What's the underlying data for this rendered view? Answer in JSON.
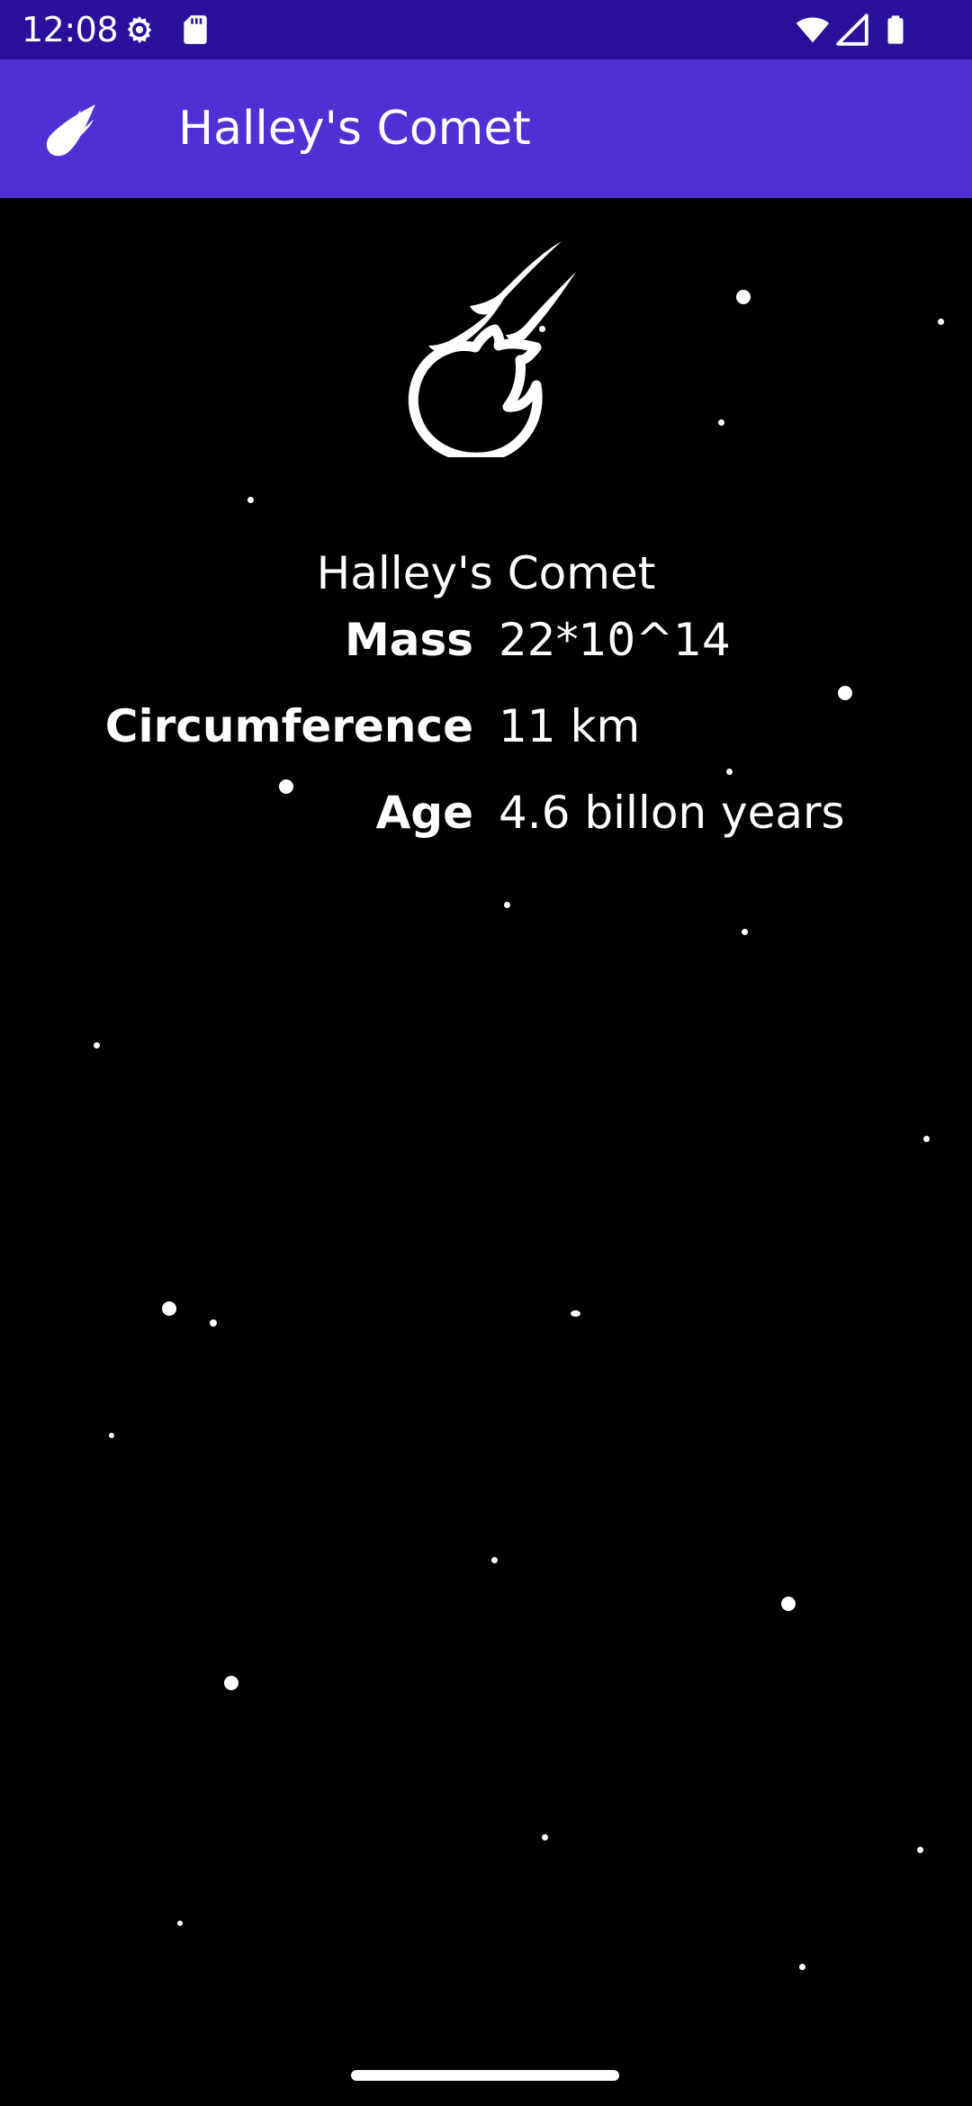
{
  "status_bar": {
    "time": "12:08",
    "left_icons": [
      "settings-icon",
      "sd-card-icon"
    ],
    "right_icons": [
      "wifi-icon",
      "cell-signal-icon",
      "battery-icon"
    ]
  },
  "app_bar": {
    "icon": "comet-icon",
    "title": "Halley's Comet",
    "background": "#5030d2"
  },
  "status_bar_color": "#2b109b",
  "content": {
    "background": "#000000",
    "image": "comet-icon",
    "title": "Halley's Comet",
    "details": [
      {
        "label": "Mass",
        "value": "22*10^14"
      },
      {
        "label": "Circumference",
        "value": "11 km"
      },
      {
        "label": "Age",
        "value": "4.6 billon years"
      }
    ]
  }
}
